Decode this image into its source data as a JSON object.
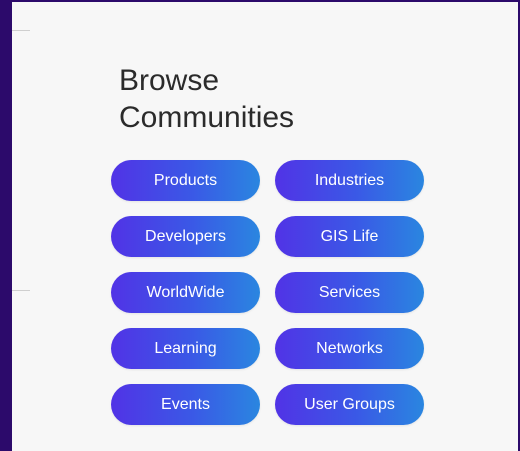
{
  "heading": {
    "line1": "Browse",
    "line2": "Communities"
  },
  "buttons": [
    {
      "label": "Products"
    },
    {
      "label": "Industries"
    },
    {
      "label": "Developers"
    },
    {
      "label": "GIS Life"
    },
    {
      "label": "WorldWide"
    },
    {
      "label": "Services"
    },
    {
      "label": "Learning"
    },
    {
      "label": "Networks"
    },
    {
      "label": "Events"
    },
    {
      "label": "User Groups"
    }
  ],
  "colors": {
    "outer_border": "#2c0a6b",
    "panel_background": "#f7f7f7",
    "button_gradient_start": "#5133e6",
    "button_gradient_end": "#2a86e0",
    "button_text": "#ffffff",
    "heading_text": "#2b2b2b"
  }
}
